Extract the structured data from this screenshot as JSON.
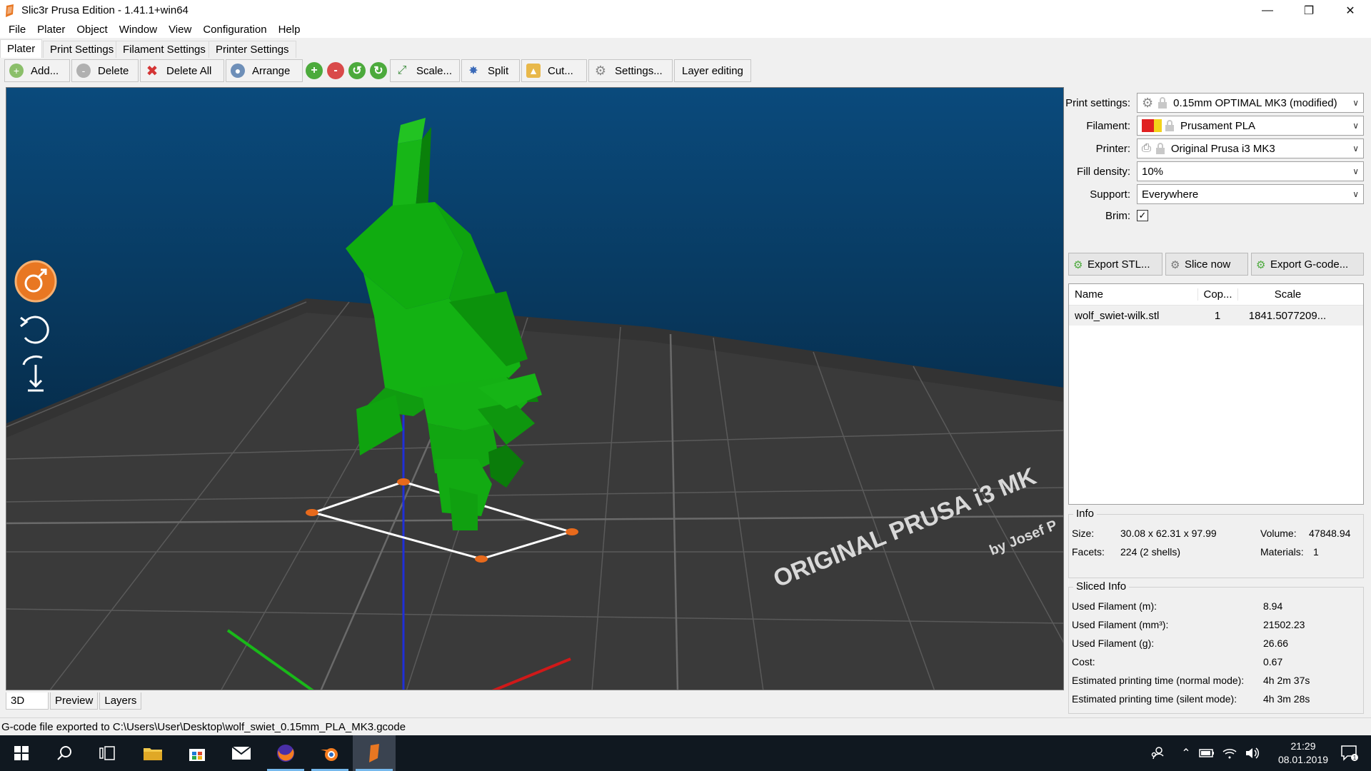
{
  "window": {
    "title": "Slic3r Prusa Edition - 1.41.1+win64"
  },
  "menu": [
    "File",
    "Plater",
    "Object",
    "Window",
    "View",
    "Configuration",
    "Help"
  ],
  "tabs": [
    "Plater",
    "Print Settings",
    "Filament Settings",
    "Printer Settings"
  ],
  "toolbar": {
    "add": "Add...",
    "delete": "Delete",
    "delete_all": "Delete All",
    "arrange": "Arrange",
    "scale": "Scale...",
    "split": "Split",
    "cut": "Cut...",
    "settings": "Settings...",
    "layer_editing": "Layer editing"
  },
  "view_tabs": [
    "3D",
    "Preview",
    "Layers"
  ],
  "bed_text": [
    "ORIGINAL PRUSA i3 MK",
    "by Josef P"
  ],
  "settings": {
    "print_label": "Print settings:",
    "print_value": "0.15mm OPTIMAL MK3 (modified)",
    "filament_label": "Filament:",
    "filament_value": "Prusament PLA",
    "printer_label": "Printer:",
    "printer_value": "Original Prusa i3 MK3",
    "fill_label": "Fill density:",
    "fill_value": "10%",
    "support_label": "Support:",
    "support_value": "Everywhere",
    "brim_label": "Brim:",
    "brim_checked": true
  },
  "actions": {
    "export_stl": "Export STL...",
    "slice_now": "Slice now",
    "export_gcode": "Export G-code..."
  },
  "object_list": {
    "headers": [
      "Name",
      "Cop...",
      "Scale"
    ],
    "rows": [
      {
        "name": "wolf_swiet-wilk.stl",
        "copies": "1",
        "scale": "1841.5077209..."
      }
    ]
  },
  "info": {
    "title": "Info",
    "size_label": "Size:",
    "size_value": "30.08 x 62.31 x 97.99",
    "volume_label": "Volume:",
    "volume_value": "47848.94",
    "facets_label": "Facets:",
    "facets_value": "224 (2 shells)",
    "materials_label": "Materials:",
    "materials_value": "1"
  },
  "sliced_info": {
    "title": "Sliced Info",
    "rows": [
      {
        "label": "Used Filament (m):",
        "value": "8.94"
      },
      {
        "label": "Used Filament (mm³):",
        "value": "21502.23"
      },
      {
        "label": "Used Filament (g):",
        "value": "26.66"
      },
      {
        "label": "Cost:",
        "value": "0.67"
      },
      {
        "label": "Estimated printing time (normal mode):",
        "value": "4h 2m 37s"
      },
      {
        "label": "Estimated printing time (silent mode):",
        "value": "4h 3m 28s"
      }
    ]
  },
  "status": "G-code file exported to C:\\Users\\User\\Desktop\\wolf_swiet_0.15mm_PLA_MK3.gcode",
  "taskbar": {
    "time": "21:29",
    "date": "08.01.2019",
    "notifications": "1"
  },
  "colors": {
    "model": "#0fa80f",
    "bed": "#3b3b3b",
    "viewport_top": "#0a4a7c",
    "accent_orange": "#e87722"
  }
}
